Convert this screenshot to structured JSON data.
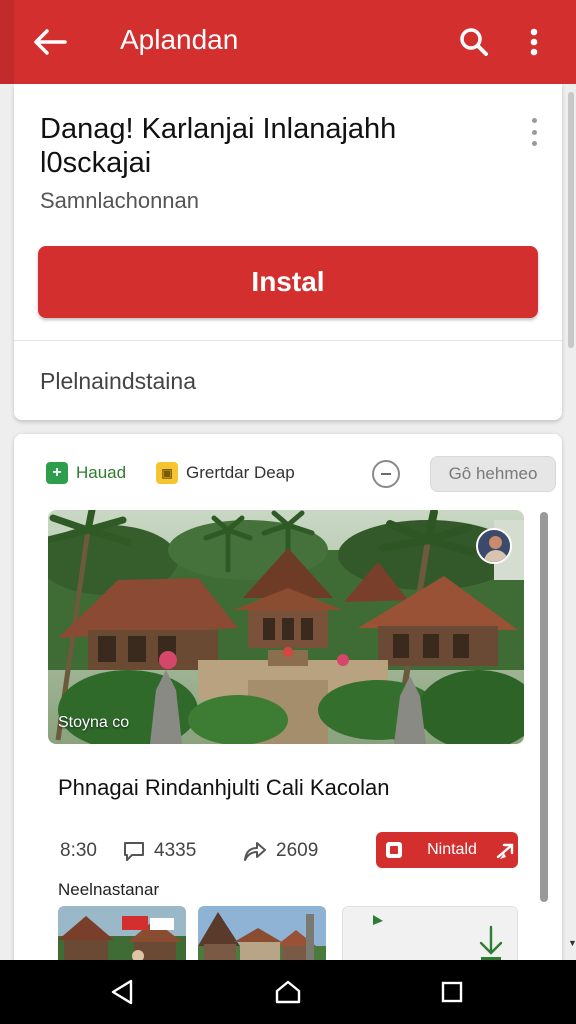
{
  "appbar": {
    "title": "Aplandan",
    "back_icon": "arrow-back-icon",
    "search_icon": "search-icon",
    "more_icon": "more-vert-icon",
    "color": "#d32f2f"
  },
  "app_card": {
    "title": "Danag! Karlanjai Inlanajahh l0sckajai",
    "developer": "Samnlachonnan",
    "install_label": "Instal",
    "footer_text": "Plelnaindstaina"
  },
  "feed_card": {
    "chips": [
      {
        "label": "Hauad",
        "icon": "plus-icon",
        "color": "#2e9e4c"
      },
      {
        "label": "Grertdar Deap",
        "icon": "badge-icon",
        "color": "#f4c531"
      }
    ],
    "pill_button_label": "Gô hehmeo",
    "hero_caption": "Stoyna co",
    "post_title": "Phnagai Rindanhjulti Cali Kacolan",
    "stats": [
      {
        "value": "8:30",
        "icon": ""
      },
      {
        "value": "4335",
        "icon": "comment-icon"
      },
      {
        "value": "2609",
        "icon": "share-icon"
      }
    ],
    "install_label": "Nintald",
    "section_label": "Neelnastanar"
  },
  "navbar": {
    "back_icon": "nav-back-icon",
    "home_icon": "nav-home-icon",
    "recents_icon": "nav-recents-icon"
  }
}
